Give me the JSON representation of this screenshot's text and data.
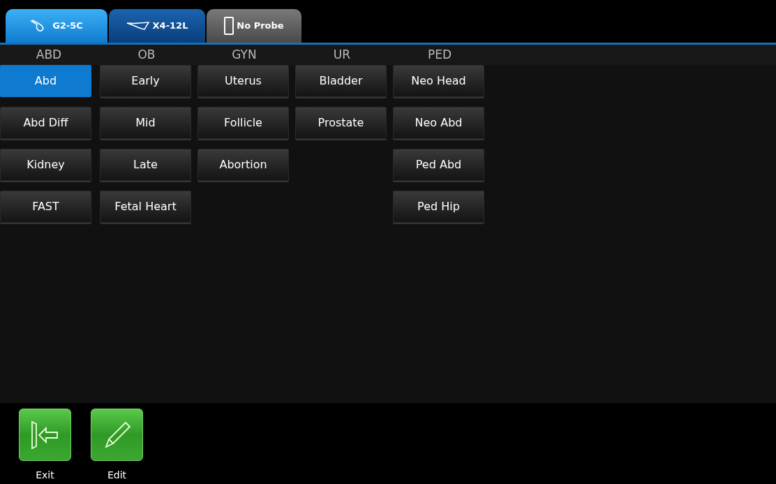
{
  "probe_tabs": [
    {
      "label": "G2-5C",
      "kind": "convex",
      "selected": true
    },
    {
      "label": "X4-12L",
      "kind": "linear",
      "selected": false
    },
    {
      "label": "No Probe",
      "kind": "none",
      "selected": false
    }
  ],
  "columns": [
    {
      "heading": "ABD",
      "presets": [
        {
          "label": "Abd",
          "selected": true
        },
        {
          "label": "Abd Diff",
          "selected": false
        },
        {
          "label": "Kidney",
          "selected": false
        },
        {
          "label": "FAST",
          "selected": false
        }
      ]
    },
    {
      "heading": "OB",
      "presets": [
        {
          "label": "Early",
          "selected": false
        },
        {
          "label": "Mid",
          "selected": false
        },
        {
          "label": "Late",
          "selected": false
        },
        {
          "label": "Fetal Heart",
          "selected": false
        }
      ]
    },
    {
      "heading": "GYN",
      "presets": [
        {
          "label": "Uterus",
          "selected": false
        },
        {
          "label": "Follicle",
          "selected": false
        },
        {
          "label": "Abortion",
          "selected": false
        }
      ]
    },
    {
      "heading": "UR",
      "presets": [
        {
          "label": "Bladder",
          "selected": false
        },
        {
          "label": "Prostate",
          "selected": false
        }
      ]
    },
    {
      "heading": "PED",
      "presets": [
        {
          "label": "Neo Head",
          "selected": false
        },
        {
          "label": "Neo Abd",
          "selected": false
        },
        {
          "label": "Ped Abd",
          "selected": false
        },
        {
          "label": "Ped Hip",
          "selected": false
        }
      ]
    }
  ],
  "actions": [
    {
      "label": "Exit",
      "kind": "exit"
    },
    {
      "label": "Edit",
      "kind": "edit"
    }
  ]
}
